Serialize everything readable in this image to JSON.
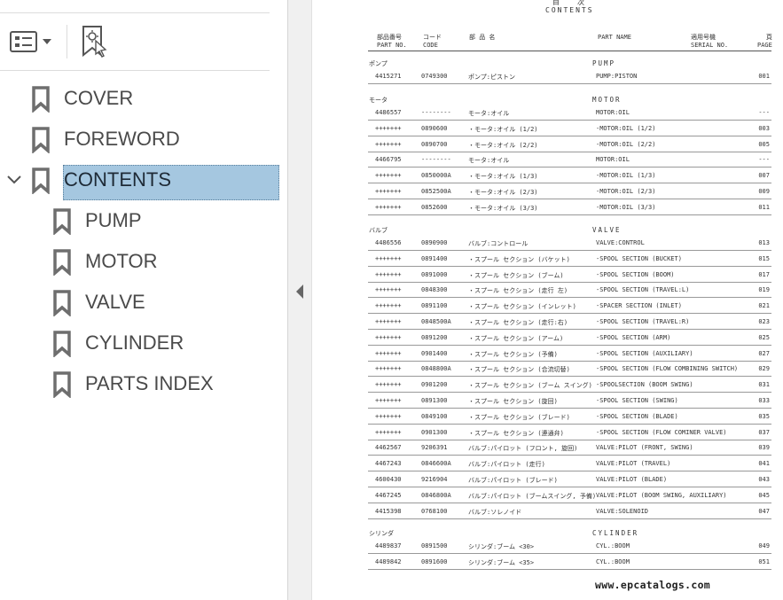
{
  "colors": {
    "selection": "#a5c7e0",
    "icon": "#6e6e6e",
    "text": "#4a4a4a"
  },
  "toolbar": {
    "options_icon": "list-options-icon",
    "find_icon": "find-bookmark-icon"
  },
  "bookmarks": [
    {
      "label": "COVER",
      "level": 0,
      "icon": "bookmark-icon"
    },
    {
      "label": "FOREWORD",
      "level": 0,
      "icon": "bookmark-icon"
    },
    {
      "label": "CONTENTS",
      "level": 0,
      "icon": "bookmark-icon",
      "expanded": true,
      "selected": true
    },
    {
      "label": "PUMP",
      "level": 1,
      "icon": "bookmark-icon"
    },
    {
      "label": "MOTOR",
      "level": 1,
      "icon": "bookmark-icon"
    },
    {
      "label": "VALVE",
      "level": 1,
      "icon": "bookmark-icon"
    },
    {
      "label": "CYLINDER",
      "level": 1,
      "icon": "bookmark-icon"
    },
    {
      "label": "PARTS INDEX",
      "level": 1,
      "icon": "bookmark-icon"
    }
  ],
  "document": {
    "title_jp": "目次",
    "title": "CONTENTS",
    "headers": {
      "part_jp": "部品番号",
      "part_en": "PART NO.",
      "code_jp": "コード",
      "code_en": "CODE",
      "name_jp": "部 品 名",
      "name_en": "PART NAME",
      "serial_jp": "適用号機",
      "serial_en": "SERIAL NO.",
      "page_jp": "頁",
      "page_en": "PAGE"
    },
    "sections": [
      {
        "jp": "ポンプ",
        "en": "PUMP",
        "rows": [
          [
            "4415271",
            "0749300",
            "ポンプ:ピストン",
            "PUMP:PISTON",
            "001"
          ]
        ]
      },
      {
        "jp": "モータ",
        "en": "MOTOR",
        "rows": [
          [
            "4486557",
            "--------",
            "モータ:オイル",
            "MOTOR:OIL",
            "---"
          ],
          [
            "+++++++",
            "0890600",
            "・モータ:オイル (1/2)",
            "-MOTOR:OIL (1/2)",
            "003"
          ],
          [
            "+++++++",
            "0890700",
            "・モータ:オイル (2/2)",
            "-MOTOR:OIL (2/2)",
            "005"
          ],
          [
            "4466795",
            "--------",
            "モータ:オイル",
            "MOTOR:OIL",
            "---"
          ],
          [
            "+++++++",
            "0850000A",
            "・モータ:オイル (1/3)",
            "-MOTOR:OIL (1/3)",
            "007"
          ],
          [
            "+++++++",
            "0852500A",
            "・モータ:オイル (2/3)",
            "-MOTOR:OIL (2/3)",
            "009"
          ],
          [
            "+++++++",
            "0852600",
            "・モータ:オイル (3/3)",
            "-MOTOR:OIL (3/3)",
            "011"
          ]
        ]
      },
      {
        "jp": "バルブ",
        "en": "VALVE",
        "rows": [
          [
            "4486556",
            "0890900",
            "バルブ:コントロール",
            "VALVE:CONTROL",
            "013"
          ],
          [
            "+++++++",
            "0891400",
            "・スプール セクション (バケット)",
            "-SPOOL SECTION (BUCKET)",
            "015"
          ],
          [
            "+++++++",
            "0891000",
            "・スプール セクション (ブーム)",
            "-SPOOL SECTION (BOOM)",
            "017"
          ],
          [
            "+++++++",
            "0848300",
            "・スプール セクション (走行 左)",
            "-SPOOL SECTION (TRAVEL:L)",
            "019"
          ],
          [
            "+++++++",
            "0891100",
            "・スプール セクション (インレット)",
            "-SPACER SECTION (INLET)",
            "021"
          ],
          [
            "+++++++",
            "0848500A",
            "・スプール セクション (走行:右)",
            "-SPOOL SECTION (TRAVEL:R)",
            "023"
          ],
          [
            "+++++++",
            "0891200",
            "・スプール セクション (アーム)",
            "-SPOOL SECTION (ARM)",
            "025"
          ],
          [
            "+++++++",
            "0901400",
            "・スプール セクション (予備)",
            "-SPOOL SECTION (AUXILIARY)",
            "027"
          ],
          [
            "+++++++",
            "0848800A",
            "・スプール セクション (合流切替)",
            "-SPOOL SECTION (FLOW COMBINING SWITCH)",
            "029"
          ],
          [
            "+++++++",
            "0901200",
            "・スプール セクション (ブーム スイング)",
            "-SPOOLSECTION (BOOM SWING)",
            "031"
          ],
          [
            "+++++++",
            "0891300",
            "・スプール セクション (旋回)",
            "-SPOOL SECTION (SWING)",
            "033"
          ],
          [
            "+++++++",
            "0849100",
            "・スプール セクション (ブレード)",
            "-SPOOL SECTION (BLADE)",
            "035"
          ],
          [
            "+++++++",
            "0901300",
            "・スプール セクション (連通弁)",
            "-SPOOL SECTION (FLOW COMINER VALVE)",
            "037"
          ],
          [
            "4462567",
            "9206391",
            "バルブ:パイロット (フロント, 旋回)",
            "VALVE:PILOT (FRONT, SWING)",
            "039"
          ],
          [
            "4467243",
            "0846600A",
            "バルブ:パイロット (走行)",
            "VALVE:PILOT (TRAVEL)",
            "041"
          ],
          [
            "4600430",
            "9216904",
            "バルブ:パイロット (ブレード)",
            "VALVE:PILOT (BLADE)",
            "043"
          ],
          [
            "4467245",
            "0846800A",
            "バルブ:パイロット (ブームスイング, 予備)",
            "VALVE:PILOT (BOOM SWING, AUXILIARY)",
            "045"
          ],
          [
            "4415398",
            "0768100",
            "バルブ:ソレノイド",
            "VALVE:SOLENOID",
            "047"
          ]
        ]
      },
      {
        "jp": "シリンダ",
        "en": "CYLINDER",
        "rows": [
          [
            "4489837",
            "0891500",
            "シリンダ:ブーム <30>",
            "CYL.:BOOM",
            "049"
          ],
          [
            "4489842",
            "0891600",
            "シリンダ:ブーム <35>",
            "CYL.:BOOM",
            "051"
          ]
        ]
      }
    ],
    "footer": "www.epcatalogs.com"
  }
}
